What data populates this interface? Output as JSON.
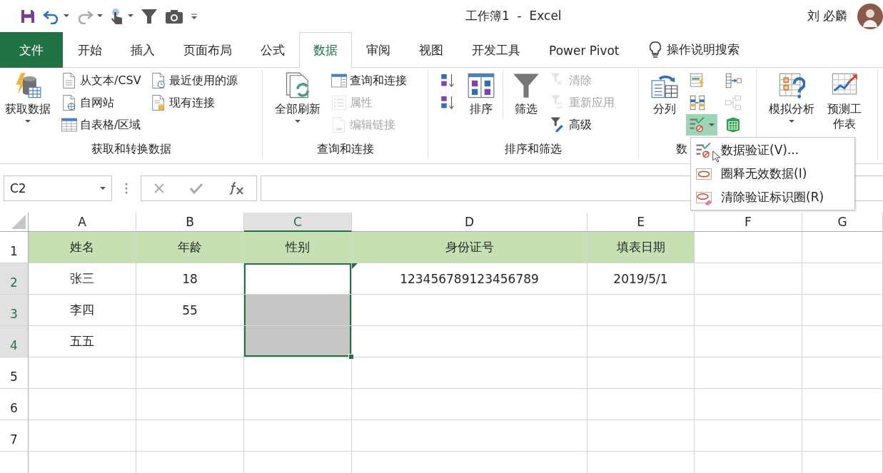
{
  "title_bar": {
    "title": "工作簿1  -  Excel",
    "user": "刘 必麟"
  },
  "tabs": [
    {
      "label": "文件",
      "kind": "file",
      "selected": false
    },
    {
      "label": "开始",
      "kind": "tab",
      "selected": false
    },
    {
      "label": "插入",
      "kind": "tab",
      "selected": false
    },
    {
      "label": "页面布局",
      "kind": "tab",
      "selected": false
    },
    {
      "label": "公式",
      "kind": "tab",
      "selected": false
    },
    {
      "label": "数据",
      "kind": "tab",
      "selected": true
    },
    {
      "label": "审阅",
      "kind": "tab",
      "selected": false
    },
    {
      "label": "视图",
      "kind": "tab",
      "selected": false
    },
    {
      "label": "开发工具",
      "kind": "tab",
      "selected": false
    },
    {
      "label": "Power Pivot",
      "kind": "tab",
      "selected": false
    }
  ],
  "tell_me": {
    "placeholder": "操作说明搜索"
  },
  "ribbon": {
    "groups": [
      {
        "label": "获取和转换数据",
        "columns": [
          {
            "items": [
              {
                "label": "获取数据",
                "kind": "large",
                "disabled": false,
                "dropdown": true
              }
            ]
          },
          {
            "items": [
              {
                "label": "从文本/CSV",
                "kind": "small",
                "disabled": false
              },
              {
                "label": "自网站",
                "kind": "small",
                "disabled": false
              },
              {
                "label": "自表格/区域",
                "kind": "small",
                "disabled": false
              }
            ]
          },
          {
            "items": [
              {
                "label": "最近使用的源",
                "kind": "small",
                "disabled": false
              },
              {
                "label": "现有连接",
                "kind": "small",
                "disabled": false
              }
            ]
          }
        ]
      },
      {
        "label": "查询和连接",
        "columns": [
          {
            "items": [
              {
                "label": "全部刷新",
                "kind": "large",
                "disabled": false,
                "dropdown": true
              }
            ]
          },
          {
            "items": [
              {
                "label": "查询和连接",
                "kind": "small",
                "disabled": false
              },
              {
                "label": "属性",
                "kind": "small",
                "disabled": true
              },
              {
                "label": "编辑链接",
                "kind": "small",
                "disabled": true
              }
            ]
          }
        ]
      },
      {
        "label": "排序和筛选",
        "columns": [
          {
            "items": [
              {
                "kind": "icon",
                "disabled": false
              },
              {
                "kind": "icon",
                "disabled": false
              }
            ]
          },
          {
            "items": [
              {
                "label": "排序",
                "kind": "large",
                "disabled": false
              }
            ]
          },
          {
            "divider": true,
            "items": [
              {
                "label": "筛选",
                "kind": "large",
                "disabled": false
              }
            ]
          },
          {
            "items": [
              {
                "label": "清除",
                "kind": "small",
                "disabled": true
              },
              {
                "label": "重新应用",
                "kind": "small",
                "disabled": true
              },
              {
                "label": "高级",
                "kind": "small",
                "disabled": false
              }
            ]
          }
        ]
      },
      {
        "label": "数",
        "columns": [
          {
            "items": [
              {
                "label": "分列",
                "kind": "large",
                "disabled": false
              }
            ]
          },
          {
            "items": [
              {
                "kind": "icon",
                "disabled": false
              },
              {
                "kind": "icon",
                "disabled": false
              },
              {
                "kind": "icon",
                "disabled": false,
                "dropdown": true,
                "expanded": true
              }
            ]
          },
          {
            "items": [
              {
                "kind": "icon",
                "disabled": false
              },
              {
                "kind": "icon",
                "disabled": true
              },
              {
                "kind": "icon",
                "disabled": false
              }
            ]
          }
        ]
      },
      {
        "columns": [
          {
            "items": [
              {
                "label": "模拟分析",
                "kind": "large",
                "disabled": false,
                "dropdown": true
              }
            ]
          },
          {
            "items": [
              {
                "label": "预测工作表",
                "kind": "large",
                "disabled": false
              }
            ]
          }
        ]
      }
    ]
  },
  "menu": {
    "items": [
      {
        "label": "数据验证(V)..."
      },
      {
        "label": "圈释无效数据(I)"
      },
      {
        "label": "清除验证标识圈(R)"
      }
    ]
  },
  "formula_bar": {
    "name_box": "C2"
  },
  "sheet": {
    "columns": [
      {
        "label": "A",
        "selected": false
      },
      {
        "label": "B",
        "selected": false
      },
      {
        "label": "C",
        "selected": true
      },
      {
        "label": "D",
        "selected": false
      },
      {
        "label": "E",
        "selected": false
      },
      {
        "label": "F",
        "selected": false
      },
      {
        "label": "G",
        "selected": false
      }
    ],
    "rows": [
      {
        "label": "1",
        "kind": "header",
        "selected": false,
        "cells": [
          {
            "text": "姓名",
            "selected": false
          },
          {
            "text": "年龄",
            "selected": false
          },
          {
            "text": "性别",
            "selected": false
          },
          {
            "text": "身份证号",
            "selected": false
          },
          {
            "text": "填表日期",
            "selected": false
          },
          {
            "selected": false
          },
          {
            "selected": false
          }
        ]
      },
      {
        "label": "2",
        "kind": "data",
        "selected": true,
        "cells": [
          {
            "text": "张三",
            "selected": false
          },
          {
            "text": "18",
            "selected": false
          },
          {
            "selected": true,
            "active": true
          },
          {
            "text": "123456789123456789",
            "selected": false,
            "error_flag": true
          },
          {
            "text": "2019/5/1",
            "selected": false
          },
          {
            "selected": false
          },
          {
            "selected": false
          }
        ]
      },
      {
        "label": "3",
        "kind": "data",
        "selected": true,
        "cells": [
          {
            "text": "李四",
            "selected": false
          },
          {
            "text": "55",
            "selected": false
          },
          {
            "selected": true
          },
          {
            "selected": false
          },
          {
            "selected": false
          },
          {
            "selected": false
          },
          {
            "selected": false
          }
        ]
      },
      {
        "label": "4",
        "kind": "data",
        "selected": true,
        "cells": [
          {
            "text": "五五",
            "selected": false
          },
          {
            "selected": false
          },
          {
            "selected": true
          },
          {
            "selected": false
          },
          {
            "selected": false
          },
          {
            "selected": false
          },
          {
            "selected": false
          }
        ]
      },
      {
        "label": "5",
        "kind": "data",
        "selected": false,
        "cells": [
          {
            "selected": false
          },
          {
            "selected": false
          },
          {
            "selected": false
          },
          {
            "selected": false
          },
          {
            "selected": false
          },
          {
            "selected": false
          },
          {
            "selected": false
          }
        ]
      },
      {
        "label": "6",
        "kind": "data",
        "selected": false,
        "cells": [
          {
            "selected": false
          },
          {
            "selected": false
          },
          {
            "selected": false
          },
          {
            "selected": false
          },
          {
            "selected": false
          },
          {
            "selected": false
          },
          {
            "selected": false
          }
        ]
      },
      {
        "label": "7",
        "kind": "data",
        "selected": false,
        "cells": [
          {
            "selected": false
          },
          {
            "selected": false
          },
          {
            "selected": false
          },
          {
            "selected": false
          },
          {
            "selected": false
          },
          {
            "selected": false
          },
          {
            "selected": false
          }
        ]
      }
    ]
  }
}
